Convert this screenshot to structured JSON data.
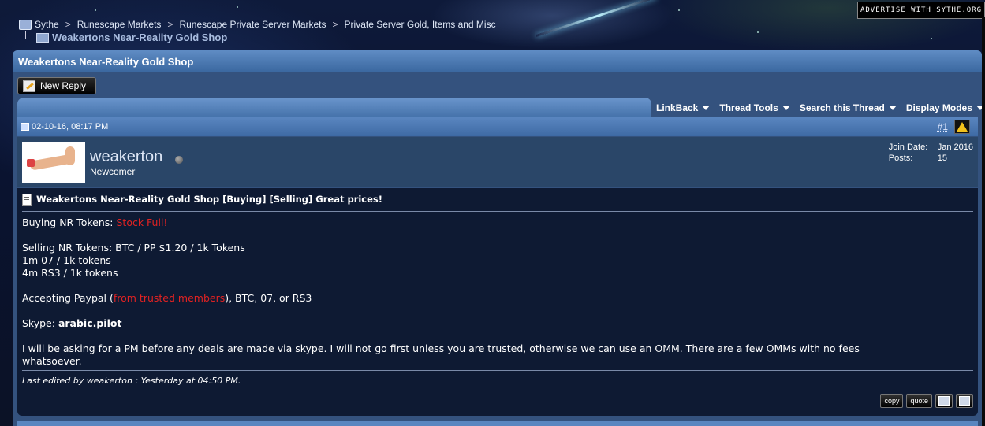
{
  "ad": {
    "label": "ADVERTISE WITH SYTHE.ORG"
  },
  "breadcrumb": {
    "items": [
      "Sythe",
      "Runescape Markets",
      "Runescape Private Server Markets",
      "Private Server Gold, Items and Misc"
    ],
    "separator": ">",
    "current": "Weakertons Near-Reality Gold Shop"
  },
  "thread": {
    "title": "Weakertons Near-Reality Gold Shop"
  },
  "buttons": {
    "new_reply": "New Reply"
  },
  "toolbar": {
    "menus": [
      "LinkBack",
      "Thread Tools",
      "Search this Thread",
      "Display Modes"
    ]
  },
  "post": {
    "date": "02-10-16, 08:17 PM",
    "number": "#1",
    "user": {
      "name": "weakerton",
      "title": "Newcomer",
      "join_label": "Join Date:",
      "join_value": "Jan 2016",
      "posts_label": "Posts:",
      "posts_value": "15"
    },
    "title": "Weakertons Near-Reality Gold Shop [Buying] [Selling] Great prices!",
    "buying_label": "Buying NR Tokens: ",
    "buying_status": "Stock Full!",
    "selling_line": "Selling NR Tokens: BTC / PP $1.20 / 1k Tokens",
    "rate_07": "1m 07 / 1k tokens",
    "rate_rs3": "4m RS3 / 1k tokens",
    "accepting_prefix": "Accepting Paypal (",
    "accepting_red": "from trusted members",
    "accepting_suffix": "), BTC, 07, or RS3",
    "skype_label": "Skype: ",
    "skype_value": "arabic.pilot",
    "notice_line1": "I will be asking for a PM before any deals are made via skype. I will not go first unless you are trusted, otherwise we can use an OMM. There are a few OMMs with no fees",
    "notice_line2": "whatsoever.",
    "edited": "Last edited by weakerton : Yesterday at 04:50 PM.",
    "actions": {
      "copy": "copy",
      "quote": "quote"
    }
  },
  "colors": {
    "accent_red": "#e22222",
    "header_blue": "#5a86c0",
    "body_dark": "#0e1a33"
  }
}
